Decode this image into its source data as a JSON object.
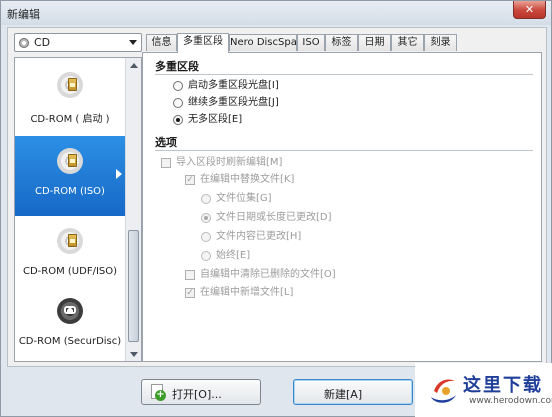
{
  "window": {
    "title": "新编辑",
    "close_label": "✕"
  },
  "source_select": {
    "value": "CD"
  },
  "sidebar": {
    "items": [
      {
        "label": "CD-ROM ( 启动 )",
        "selected": false,
        "icon": "cd-boot-icon"
      },
      {
        "label": "CD-ROM (ISO)",
        "selected": true,
        "icon": "cd-iso-icon"
      },
      {
        "label": "CD-ROM (UDF/ISO)",
        "selected": false,
        "icon": "cd-udf-iso-icon"
      },
      {
        "label": "CD-ROM (SecurDisc)",
        "selected": false,
        "icon": "cd-securdisc-icon"
      }
    ]
  },
  "tabs": [
    {
      "label": "信息",
      "active": false
    },
    {
      "label": "多重区段",
      "active": true
    },
    {
      "label": "Nero DiscSpan",
      "active": false
    },
    {
      "label": "ISO",
      "active": false
    },
    {
      "label": "标签",
      "active": false
    },
    {
      "label": "日期",
      "active": false
    },
    {
      "label": "其它",
      "active": false
    },
    {
      "label": "刻录",
      "active": false
    }
  ],
  "multisession": {
    "title": "多重区段",
    "options": [
      {
        "label": "启动多重区段光盘[I]",
        "checked": false
      },
      {
        "label": "继续多重区段光盘[J]",
        "checked": false
      },
      {
        "label": "无多区段[E]",
        "checked": true
      }
    ]
  },
  "options": {
    "title": "选项",
    "import_refresh": {
      "label": "导入区段时刷新编辑[M]",
      "checked": false,
      "disabled": true
    },
    "replace_in_compilation": {
      "label": "在编辑中替换文件[K]",
      "checked": true,
      "disabled": true
    },
    "replace_modes": [
      {
        "label": "文件位集[G]",
        "checked": false
      },
      {
        "label": "文件日期或长度已更改[D]",
        "checked": true
      },
      {
        "label": "文件内容已更改[H]",
        "checked": false
      },
      {
        "label": "始终[E]",
        "checked": false
      }
    ],
    "remove_deleted": {
      "label": "自编辑中清除已删除的文件[O]",
      "checked": false,
      "disabled": true
    },
    "add_new_files": {
      "label": "在编辑中新增文件[L]",
      "checked": true,
      "disabled": true
    }
  },
  "buttons": {
    "open_label": "打开[O]...",
    "new_label": "新建[A]"
  },
  "watermark": {
    "name": "这里下载",
    "url": "www.herodown.com"
  }
}
